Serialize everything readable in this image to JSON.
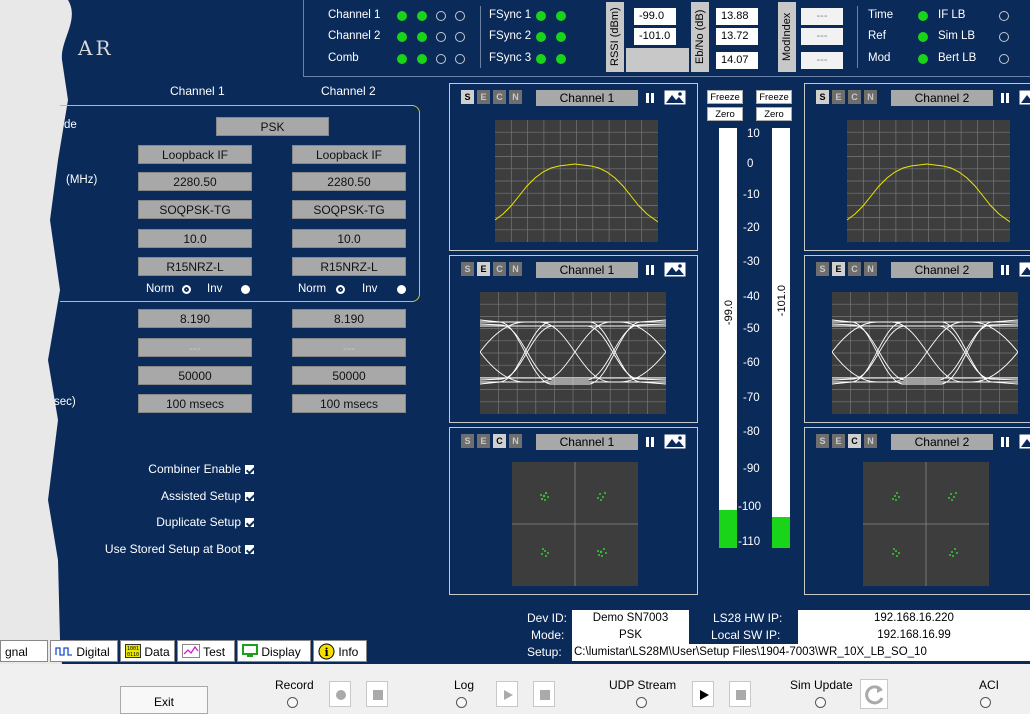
{
  "logo_text": "AR",
  "status": {
    "rows": [
      {
        "label": "Channel 1",
        "leds": [
          "on",
          "on",
          "off",
          "off"
        ]
      },
      {
        "label": "Channel 2",
        "leds": [
          "on",
          "on",
          "off",
          "off"
        ]
      },
      {
        "label": "Comb",
        "leds": [
          "on",
          "on",
          "off",
          "off"
        ]
      }
    ],
    "fsync": [
      {
        "label": "FSync 1",
        "leds": [
          "on",
          "on"
        ]
      },
      {
        "label": "FSync 2",
        "leds": [
          "on",
          "on"
        ]
      },
      {
        "label": "FSync 3",
        "leds": [
          "on",
          "on"
        ]
      }
    ],
    "rssi_label": "RSSI (dBm)",
    "rssi_values": [
      "-99.0",
      "-101.0"
    ],
    "ebno_label": "Eb/No (dB)",
    "ebno_values": [
      "13.88",
      "13.72",
      "14.07"
    ],
    "modindex_label": "ModIndex",
    "modindex_values": [
      "---",
      "---",
      "---"
    ],
    "right": [
      {
        "label": "Time",
        "sub": "IF LB"
      },
      {
        "label": "Ref",
        "sub": "Sim LB"
      },
      {
        "label": "Mod",
        "sub": "Bert LB"
      }
    ]
  },
  "config": {
    "col1": "Channel 1",
    "col2": "Channel 2",
    "row_labels": [
      "de",
      "(MHz)",
      "sec)"
    ],
    "mode": "PSK",
    "source": [
      "Loopback IF",
      "Loopback IF"
    ],
    "freq": [
      "2280.50",
      "2280.50"
    ],
    "modulation": [
      "SOQPSK-TG",
      "SOQPSK-TG"
    ],
    "bitrate": [
      "10.0",
      "10.0"
    ],
    "code": [
      "R15NRZ-L",
      "R15NRZ-L"
    ],
    "norm": "Norm",
    "inv": "Inv",
    "val1": [
      "8.190",
      "8.190"
    ],
    "val2": [
      "---",
      "---"
    ],
    "val3": [
      "50000",
      "50000"
    ],
    "val4": [
      "100 msecs",
      "100 msecs"
    ]
  },
  "checks": [
    "Combiner Enable",
    "Assisted Setup",
    "Duplicate Setup",
    "Use Stored Setup at Boot"
  ],
  "plots": {
    "ch1": "Channel 1",
    "ch2": "Channel 2",
    "btn_s": "S",
    "btn_e": "E",
    "btn_c": "C",
    "btn_n": "N"
  },
  "meter": {
    "freeze": "Freeze",
    "zero": "Zero",
    "ticks": [
      "10",
      "0",
      "-10",
      "-20",
      "-30",
      "-40",
      "-50",
      "-60",
      "-70",
      "-80",
      "-90",
      "-100",
      "-110"
    ],
    "left_readout": "-99.0",
    "right_readout": "-101.0"
  },
  "device": {
    "devid_label": "Dev ID:",
    "devid": "Demo SN7003",
    "mode_label": "Mode:",
    "mode": "PSK",
    "setup_label": "Setup:",
    "setup": "C:\\lumistar\\LS28M\\User\\Setup Files\\1904-7003\\WR_10X_LB_SO_10",
    "hwip_label": "LS28 HW IP:",
    "hwip": "192.168.16.220",
    "swip_label": "Local SW IP:",
    "swip": "192.168.16.99"
  },
  "tabs": [
    "gnal",
    "Digital",
    "Data",
    "Test",
    "Display",
    "Info"
  ],
  "bottom": {
    "exit": "Exit",
    "record": "Record",
    "log": "Log",
    "udp": "UDP Stream",
    "sim": "Sim Update",
    "aci": "ACI"
  },
  "colors": {
    "bg": "#0a2a5a",
    "led": "#19d419",
    "trace": "#e8e800",
    "constellation": "#2fd12f"
  }
}
